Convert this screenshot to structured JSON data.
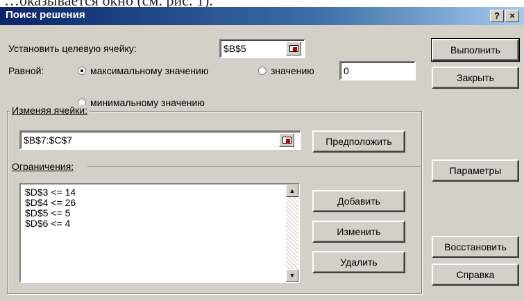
{
  "caption": "…оказывается окно (см. рис. 1).",
  "titlebar": {
    "title": "Поиск решения",
    "help_label": "?",
    "close_label": "×"
  },
  "target_cell": {
    "label": "Установить целевую ячейку:",
    "value": "$B$5"
  },
  "equal_to": {
    "label": "Равной:",
    "options": [
      {
        "label": "максимальному значению",
        "selected": true
      },
      {
        "label": "значению",
        "selected": false
      },
      {
        "label": "минимальному значению",
        "selected": false
      }
    ],
    "value_field": "0"
  },
  "changing_cells": {
    "legend": "Изменяя ячейки:",
    "value": "$B$7:$C$7",
    "guess_label": "Предположить"
  },
  "constraints": {
    "legend": "Ограничения:",
    "items": [
      "$D$3 <= 14",
      "$D$4 <= 26",
      "$D$5 <= 5",
      "$D$6 <= 4"
    ],
    "add_label": "Добавить",
    "change_label": "Изменить",
    "delete_label": "Удалить"
  },
  "right_buttons": {
    "solve": "Выполнить",
    "close": "Закрыть",
    "options": "Параметры",
    "reset": "Восстановить",
    "help": "Справка"
  }
}
